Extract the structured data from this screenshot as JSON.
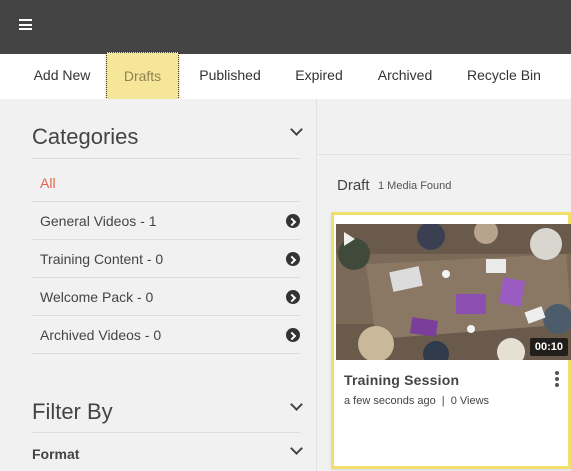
{
  "tabs": [
    {
      "label": "Add New"
    },
    {
      "label": "Drafts"
    },
    {
      "label": "Published"
    },
    {
      "label": "Expired"
    },
    {
      "label": "Archived"
    },
    {
      "label": "Recycle Bin"
    }
  ],
  "active_tab": "Drafts",
  "sidebar": {
    "categories_title": "Categories",
    "categories": [
      {
        "label": "All"
      },
      {
        "label": "General Videos - 1"
      },
      {
        "label": "Training Content - 0"
      },
      {
        "label": "Welcome Pack - 0"
      },
      {
        "label": "Archived Videos - 0"
      }
    ],
    "filter_title": "Filter By",
    "format_label": "Format"
  },
  "main": {
    "section_title": "Draft",
    "media_count": "1 Media Found",
    "media": [
      {
        "title": "Training Session",
        "uploaded": "a few seconds ago",
        "separator": "|",
        "views": "0 Views",
        "duration": "00:10"
      }
    ]
  },
  "colors": {
    "topbar": "#444444",
    "active_tab_bg": "#f6e69a",
    "card_highlight": "#f2de6b",
    "all_category": "#e2644a"
  },
  "icons": {
    "menu": "hamburger-menu-icon",
    "collapse": "chevron-down-icon",
    "category_go": "circle-arrow-right-icon",
    "play": "play-icon",
    "more": "kebab-menu-icon"
  }
}
